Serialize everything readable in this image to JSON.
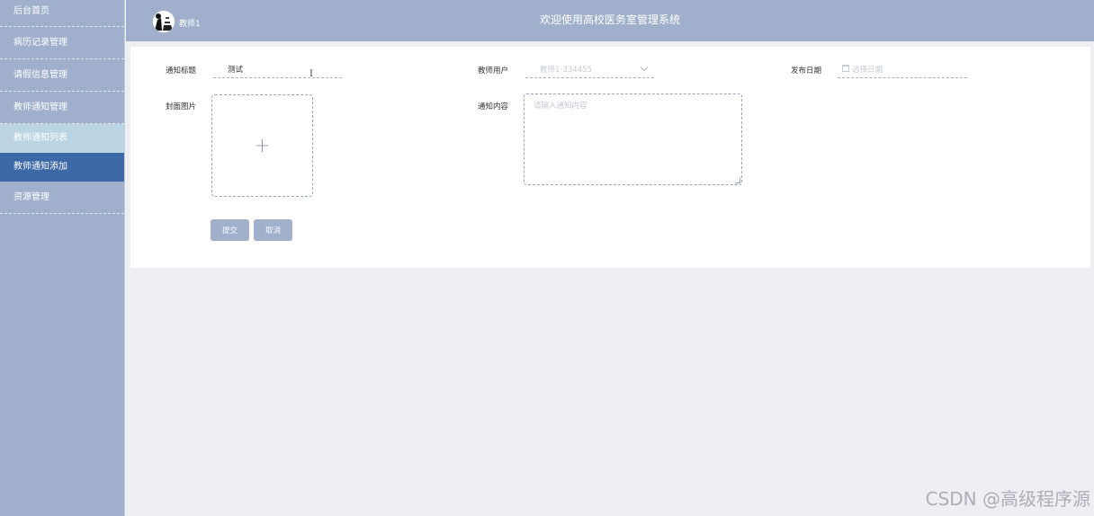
{
  "header": {
    "user_name": "教师1",
    "site_title": "欢迎使用高校医务室管理系统"
  },
  "sidebar": {
    "items": [
      {
        "label": "后台首页"
      },
      {
        "label": "病历记录管理"
      },
      {
        "label": "请假信息管理"
      },
      {
        "label": "教师通知管理"
      },
      {
        "label": "教师通知列表"
      },
      {
        "label": "教师通知添加"
      },
      {
        "label": "资源管理"
      }
    ]
  },
  "form": {
    "title_label": "通知标题",
    "title_value": "测试",
    "teacher_label": "教师用户",
    "teacher_value": "教师1-334455",
    "date_label": "发布日期",
    "date_placeholder": "选择日期",
    "cover_label": "封面图片",
    "upload_plus": "+",
    "content_label": "通知内容",
    "content_placeholder": "请输入通知内容",
    "submit_label": "提交",
    "cancel_label": "取消"
  },
  "watermark": "CSDN @高级程序源",
  "colors": {
    "sidebar_bg": "#a0afcb",
    "active_item": "#3d68a7",
    "sub_item": "#bad4e4",
    "button": "#a0afcb"
  }
}
